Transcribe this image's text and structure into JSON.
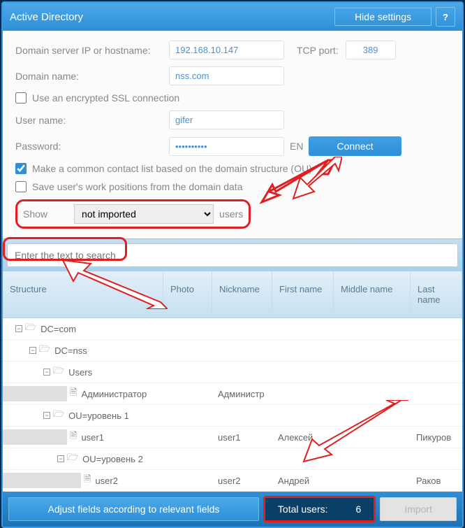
{
  "header": {
    "title": "Active Directory",
    "hide_btn": "Hide settings",
    "help_btn": "?"
  },
  "settings": {
    "domain_server_label": "Domain server IP or hostname:",
    "domain_server_value": "192.168.10.147",
    "tcp_label": "TCP port:",
    "tcp_value": "389",
    "domain_name_label": "Domain name:",
    "domain_name_value": "nss.com",
    "ssl_label": "Use an encrypted SSL connection",
    "ssl_checked": false,
    "user_label": "User name:",
    "user_value": "gifer",
    "pass_label": "Password:",
    "pass_value": "••••••••••",
    "lang": "EN",
    "connect_btn": "Connect",
    "make_common_label": "Make a common contact list based on the domain structure (OU)",
    "make_common_checked": true,
    "save_pos_label": "Save user's work positions from the domain data",
    "save_pos_checked": false,
    "show_label": "Show",
    "show_select": "not imported",
    "show_suffix": "users"
  },
  "search": {
    "placeholder": "Enter the text to search"
  },
  "columns": {
    "structure": "Structure",
    "photo": "Photo",
    "nick": "Nickname",
    "fn": "First name",
    "mn": "Middle name",
    "ln": "Last name"
  },
  "tree": {
    "n0": "DC=com",
    "n1": "DC=nss",
    "n2": "Users",
    "n3": "Администратор",
    "n3_nick": "Администр",
    "n4": "OU=уровень 1",
    "n5": "user1",
    "n5_nick": "user1",
    "n5_fn": "Алексей",
    "n5_ln": "Пикуров",
    "n6": "OU=уровень 2",
    "n7": "user2",
    "n7_nick": "user2",
    "n7_fn": "Андрей",
    "n7_ln": "Раков"
  },
  "footer": {
    "adjust": "Adjust fields according to relevant fields",
    "total_label": "Total users:",
    "total_value": "6",
    "import_btn": "Import"
  }
}
